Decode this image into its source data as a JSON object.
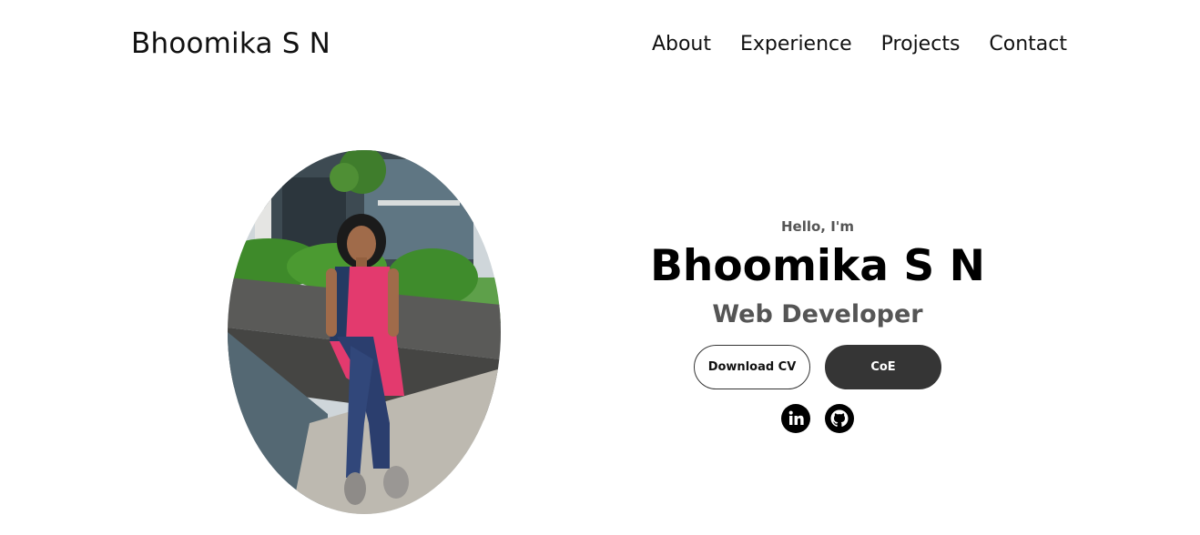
{
  "nav": {
    "logo": "Bhoomika S N",
    "links": [
      "About",
      "Experience",
      "Projects",
      "Contact"
    ]
  },
  "hero": {
    "greeting": "Hello, I'm",
    "name": "Bhoomika S N",
    "role": "Web Developer",
    "buttons": {
      "download": "Download CV",
      "coe": "CoE"
    },
    "socials": [
      "linkedin-icon",
      "github-icon"
    ],
    "profile_picture": "profile-photo"
  },
  "colors": {
    "text": "#111111",
    "muted": "#555555",
    "button_dark": "#353535",
    "background": "#ffffff"
  }
}
